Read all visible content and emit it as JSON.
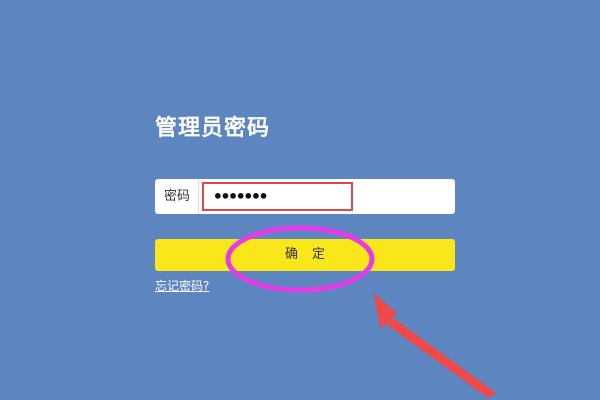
{
  "page": {
    "title": "管理员密码"
  },
  "password_field": {
    "label": "密码",
    "value": "•••••••"
  },
  "confirm_button": {
    "label": "确定"
  },
  "forgot_link": {
    "label": "忘记密码?"
  },
  "colors": {
    "background": "#5d85c0",
    "button": "#f9e71b",
    "input_border": "#d94a4f",
    "annotation_ellipse": "#e53ce8",
    "annotation_arrow": "#ef4a4a"
  }
}
